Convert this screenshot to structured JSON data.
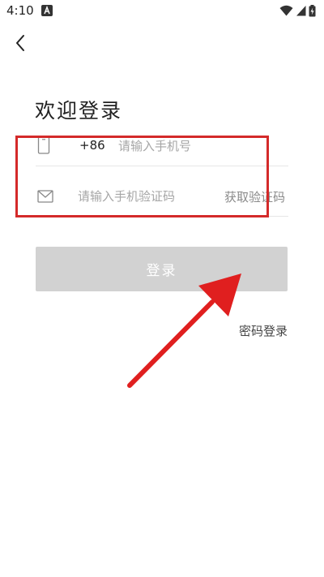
{
  "status_bar": {
    "time": "4:10"
  },
  "header": {
    "title": "欢迎登录"
  },
  "form": {
    "country_code": "+86",
    "phone_placeholder": "请输入手机号",
    "code_placeholder": "请输入手机验证码",
    "get_code_label": "获取验证码"
  },
  "actions": {
    "login_label": "登录",
    "password_login_label": "密码登录"
  },
  "colors": {
    "annotation": "#d42a2a",
    "login_button_bg": "#d2d2d2"
  },
  "icons": {
    "back": "chevron-left-icon",
    "phone": "phone-icon",
    "mail": "mail-icon"
  }
}
